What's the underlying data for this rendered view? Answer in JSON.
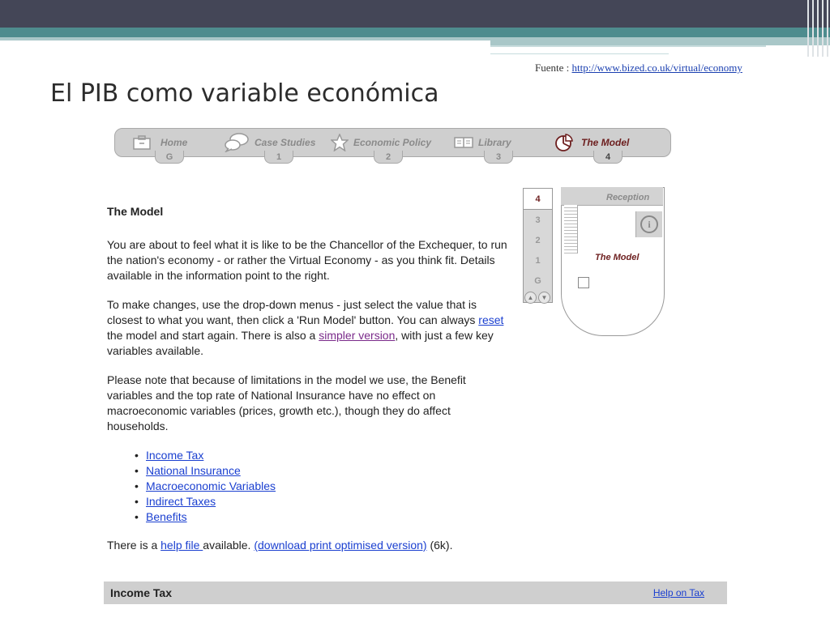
{
  "slide": {
    "source_prefix": "Fuente : ",
    "source_url": "http://www.bized.co.uk/virtual/economy",
    "title": "El PIB como variable económica"
  },
  "nav": {
    "items": [
      {
        "label": "Home",
        "tab": "G",
        "icon": "briefcase-icon"
      },
      {
        "label": "Case Studies",
        "tab": "1",
        "icon": "speech-bubbles-icon"
      },
      {
        "label": "Economic Policy",
        "tab": "2",
        "icon": "star-icon"
      },
      {
        "label": "Library",
        "tab": "3",
        "icon": "book-icon"
      },
      {
        "label": "The Model",
        "tab": "4",
        "icon": "pie-chart-icon"
      }
    ]
  },
  "content": {
    "heading": "The Model",
    "p1": "You are about to feel what it is like to be the Chancellor of the Exchequer, to run the nation's economy - or rather the Virtual Economy - as you think fit. Details available in the information point to the right.",
    "p2_a": "To make changes, use the drop-down menus - just select the value that is closest to what you want, then click a 'Run Model' button. You can always ",
    "p2_reset": "reset",
    "p2_b": " the model and start again. There is also a ",
    "p2_simpler": "simpler version",
    "p2_c": ", with just a few key variables available.",
    "p3": "Please note that because of limitations in the model we use, the Benefit variables and the top rate of National Insurance have no effect on macroeconomic variables (prices, growth etc.), though they do affect households.",
    "links": [
      "Income Tax",
      "National Insurance",
      "Macroeconomic Variables",
      "Indirect Taxes",
      "Benefits"
    ],
    "help_a": "There is a ",
    "help_link": "help file ",
    "help_b": "available. ",
    "download_link": "(download print optimised version)",
    "help_c": " (6k)."
  },
  "floors": [
    "4",
    "3",
    "2",
    "1",
    "G"
  ],
  "map": {
    "reception": "Reception",
    "model": "The Model"
  },
  "section": {
    "title": "Income Tax",
    "help": "Help on Tax"
  }
}
